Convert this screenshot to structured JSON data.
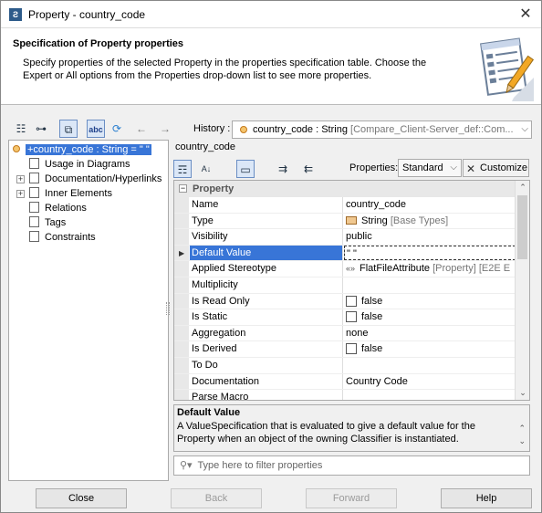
{
  "window": {
    "title": "Property - country_code",
    "app_icon": "magicdraw-app-icon",
    "close_glyph": "✕"
  },
  "header": {
    "title": "Specification of Property properties",
    "description": "Specify properties of the selected Property in the properties specification table. Choose the Expert or All options from the Properties drop-down list to see more properties."
  },
  "history": {
    "label": "History :",
    "value": "country_code : String",
    "value_grey": "[Compare_Client-Server_def::Com..."
  },
  "tree": {
    "root": "+country_code : String = \" \"",
    "items": [
      {
        "label": "Usage in Diagrams",
        "expandable": false
      },
      {
        "label": "Documentation/Hyperlinks",
        "expandable": true
      },
      {
        "label": "Inner Elements",
        "expandable": true
      },
      {
        "label": "Relations",
        "expandable": false
      },
      {
        "label": "Tags",
        "expandable": false
      },
      {
        "label": "Constraints",
        "expandable": false
      }
    ]
  },
  "panel": {
    "title": "country_code",
    "properties_label": "Properties:",
    "properties_mode": "Standard",
    "customize_label": "Customize",
    "group_label": "Property",
    "rows": [
      {
        "name": "Name",
        "value": "country_code"
      },
      {
        "name": "Type",
        "value": "String",
        "value_grey": "[Base Types]"
      },
      {
        "name": "Visibility",
        "value": "public"
      },
      {
        "name": "Default Value",
        "value": "\" \""
      },
      {
        "name": "Applied Stereotype",
        "value": "FlatFileAttribute",
        "value_grey": "[Property] [E2E E"
      },
      {
        "name": "Multiplicity",
        "value": ""
      },
      {
        "name": "Is Read Only",
        "value": "false"
      },
      {
        "name": "Is Static",
        "value": "false"
      },
      {
        "name": "Aggregation",
        "value": "none"
      },
      {
        "name": "Is Derived",
        "value": "false"
      },
      {
        "name": "To Do",
        "value": ""
      },
      {
        "name": "Documentation",
        "value": "Country Code"
      },
      {
        "name": "Parse Macro",
        "value": ""
      }
    ],
    "description_title": "Default Value",
    "description_text": "A ValueSpecification that is evaluated to give a default value for the Property when an object of the owning Classifier is instantiated.",
    "filter_placeholder": "Type here to filter properties"
  },
  "footer": {
    "close": "Close",
    "back": "Back",
    "forward": "Forward",
    "help": "Help"
  }
}
